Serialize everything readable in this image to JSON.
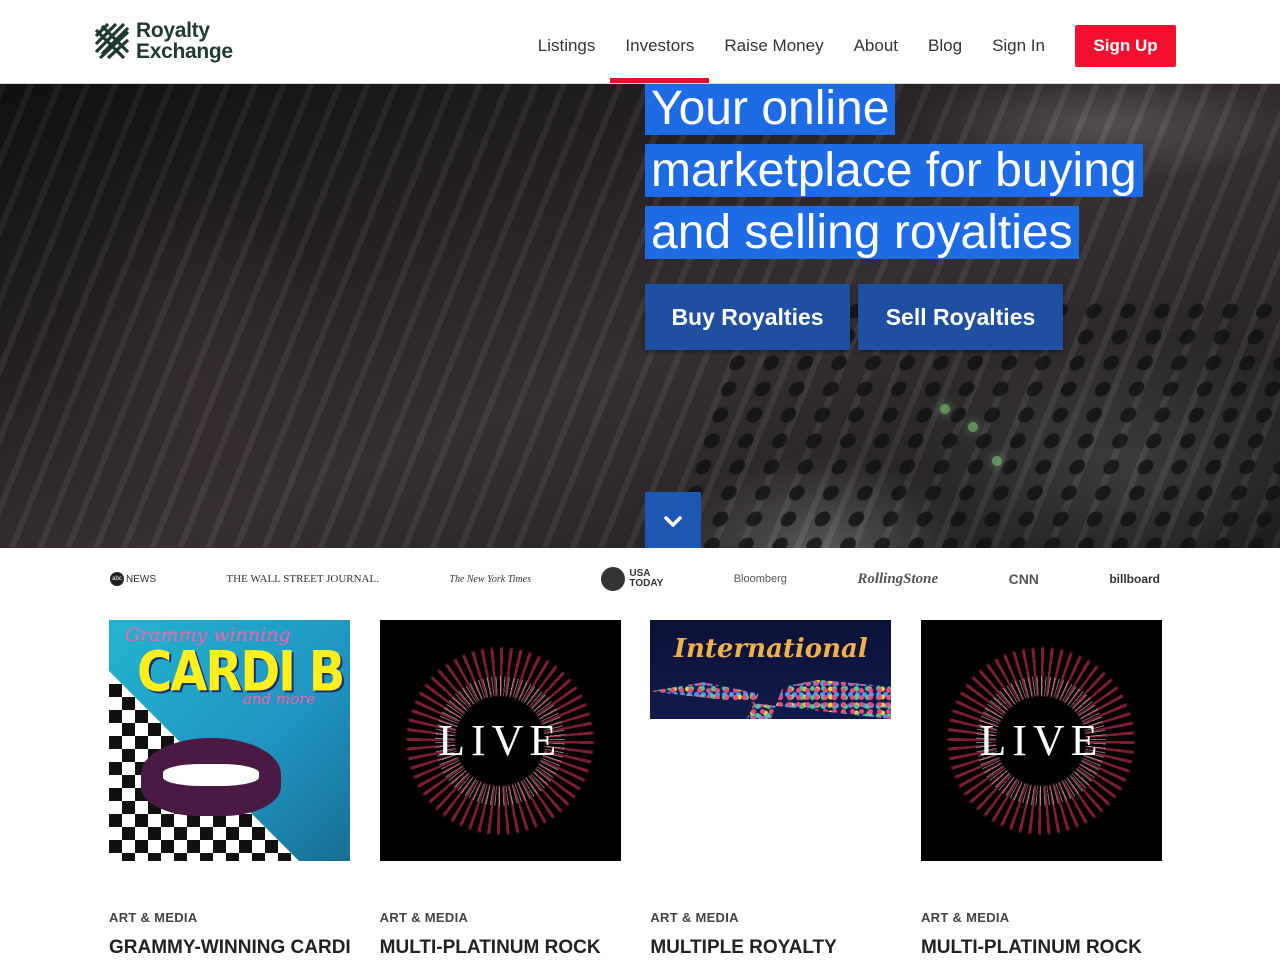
{
  "brand": {
    "line1": "Royalty",
    "line2": "Exchange"
  },
  "nav": {
    "items": [
      {
        "label": "Listings"
      },
      {
        "label": "Investors"
      },
      {
        "label": "Raise Money"
      },
      {
        "label": "About"
      },
      {
        "label": "Blog"
      },
      {
        "label": "Sign In"
      }
    ],
    "active": "Investors",
    "signup_label": "Sign Up"
  },
  "hero": {
    "title_lines": [
      "Your online",
      "marketplace for buying",
      "and selling royalties"
    ],
    "buy_label": "Buy Royalties",
    "sell_label": "Sell Royalties"
  },
  "press": {
    "abc": "NEWS",
    "wsj": "THE WALL STREET JOURNAL.",
    "nyt": "The New York Times",
    "usa": [
      "USA",
      "TODAY"
    ],
    "bloomberg": "Bloomberg",
    "rollingstone": "RollingStone",
    "cnn": "CNN",
    "billboard": "billboard"
  },
  "cards": [
    {
      "category": "ART & MEDIA",
      "title": "GRAMMY-WINNING CARDI",
      "art": {
        "script": "Grammy winning",
        "big": "CARDI B",
        "and": "and more"
      }
    },
    {
      "category": "ART & MEDIA",
      "title": "MULTI-PLATINUM ROCK",
      "art": {
        "word": "LIVE"
      }
    },
    {
      "category": "ART & MEDIA",
      "title": "MULTIPLE ROYALTY",
      "art": {
        "word": "International"
      }
    },
    {
      "category": "ART & MEDIA",
      "title": "MULTI-PLATINUM ROCK",
      "art": {
        "word": "LIVE"
      }
    }
  ],
  "colors": {
    "accent_red": "#f40f2f",
    "hero_blue": "#1e6be6",
    "button_blue": "#1e4fa0"
  }
}
